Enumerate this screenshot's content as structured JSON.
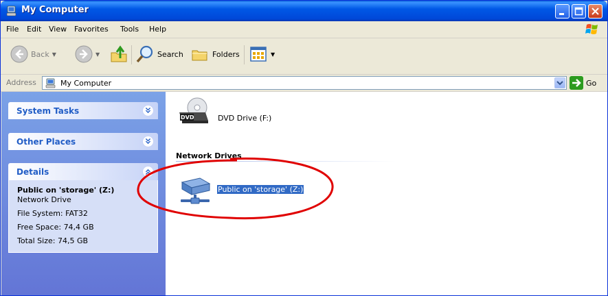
{
  "window": {
    "title": "My Computer"
  },
  "menu": {
    "items": [
      "File",
      "Edit",
      "View",
      "Favorites",
      "Tools",
      "Help"
    ]
  },
  "toolbar": {
    "back_label": "Back",
    "search_label": "Search",
    "folders_label": "Folders"
  },
  "address": {
    "label": "Address",
    "value": "My Computer",
    "go_label": "Go"
  },
  "taskpane": {
    "system_tasks": {
      "title": "System Tasks"
    },
    "other_places": {
      "title": "Other Places"
    },
    "details": {
      "title": "Details",
      "name": "Public on 'storage' (Z:)",
      "type": "Network Drive",
      "file_system": "File System: FAT32",
      "free_space": "Free Space: 74,4 GB",
      "total_size": "Total Size: 74,5 GB"
    }
  },
  "content": {
    "dvd_drive": {
      "label": "DVD Drive (F:)",
      "badge": "DVD"
    },
    "network_group": {
      "title": "Network Drives"
    },
    "network_drive": {
      "label": "Public on 'storage' (Z:)"
    }
  },
  "colors": {
    "title_bar": "#0058e6",
    "task_pane": "#7ba2e7",
    "panel_title": "#215dc6",
    "selection": "#316ac5",
    "annotation": "#e00000"
  }
}
